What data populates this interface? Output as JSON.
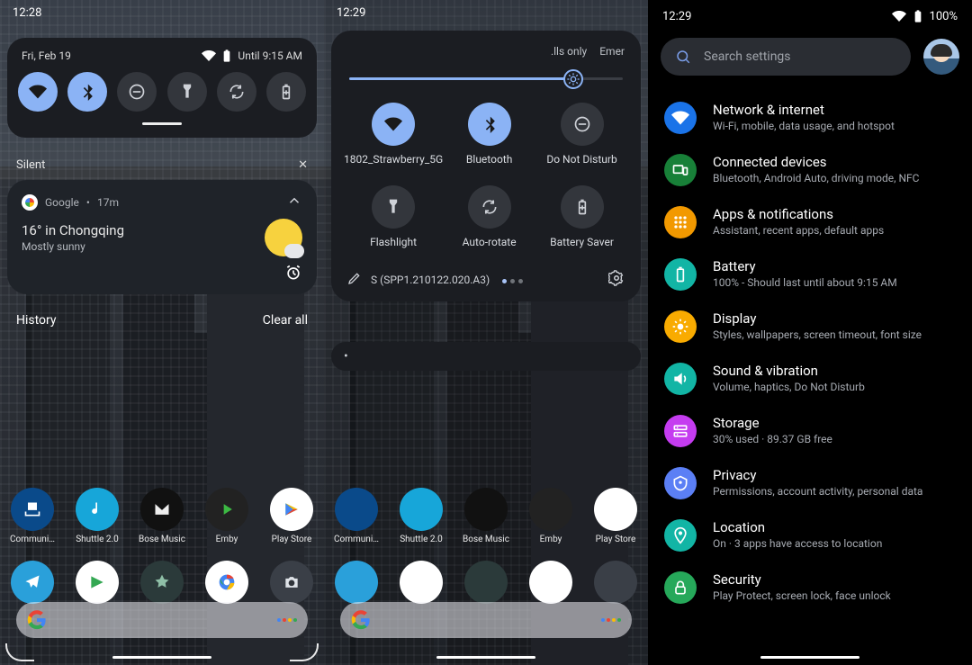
{
  "panel1": {
    "clock": "12:28",
    "date": "Fri, Feb 19",
    "until": "Until 9:15 AM",
    "qs": [
      {
        "name": "wifi",
        "on": true
      },
      {
        "name": "bluetooth",
        "on": true
      },
      {
        "name": "dnd",
        "on": false
      },
      {
        "name": "flashlight",
        "on": false
      },
      {
        "name": "autorotate",
        "on": false
      },
      {
        "name": "battery-saver",
        "on": false
      }
    ],
    "silent_label": "Silent",
    "notif": {
      "source": "Google",
      "age": "17m",
      "title": "16° in Chongqing",
      "sub": "Mostly sunny"
    },
    "history": "History",
    "clear_all": "Clear all",
    "apps": [
      "Communi…",
      "Shuttle 2.0",
      "Bose Music",
      "Emby",
      "Play Store"
    ]
  },
  "panel2": {
    "clock": "12:29",
    "ticker": [
      ".lls only",
      "Emer"
    ],
    "brightness_pct": 82,
    "tiles": [
      {
        "label": "1802_Strawberry_5G",
        "icon": "wifi",
        "on": true
      },
      {
        "label": "Bluetooth",
        "icon": "bluetooth",
        "on": true
      },
      {
        "label": "Do Not Disturb",
        "icon": "dnd",
        "on": false
      },
      {
        "label": "Flashlight",
        "icon": "flashlight",
        "on": false
      },
      {
        "label": "Auto-rotate",
        "icon": "autorotate",
        "on": false
      },
      {
        "label": "Battery Saver",
        "icon": "battery-saver",
        "on": false
      }
    ],
    "build": "S (SPP1.210122.020.A3)",
    "media_dot": "•",
    "apps": [
      "Communi…",
      "Shuttle 2.0",
      "Bose Music",
      "Emby",
      "Play Store"
    ]
  },
  "panel3": {
    "clock": "12:29",
    "battery": "100%",
    "search_placeholder": "Search settings",
    "items": [
      {
        "title": "Network & internet",
        "sub": "Wi-Fi, mobile, data usage, and hotspot",
        "color": "#1a73e8",
        "icon": "wifi"
      },
      {
        "title": "Connected devices",
        "sub": "Bluetooth, Android Auto, driving mode, NFC",
        "color": "#188038",
        "icon": "devices"
      },
      {
        "title": "Apps & notifications",
        "sub": "Assistant, recent apps, default apps",
        "color": "#f29900",
        "icon": "apps"
      },
      {
        "title": "Battery",
        "sub": "100% - Should last until about 9:15 AM",
        "color": "#12b5a5",
        "icon": "battery"
      },
      {
        "title": "Display",
        "sub": "Styles, wallpapers, screen timeout, font size",
        "color": "#f9ab00",
        "icon": "display"
      },
      {
        "title": "Sound & vibration",
        "sub": "Volume, haptics, Do Not Disturb",
        "color": "#12b5a5",
        "icon": "sound"
      },
      {
        "title": "Storage",
        "sub": "30% used · 89.37 GB free",
        "color": "#c53cf0",
        "icon": "storage"
      },
      {
        "title": "Privacy",
        "sub": "Permissions, account activity, personal data",
        "color": "#5b7ff5",
        "icon": "privacy"
      },
      {
        "title": "Location",
        "sub": "On · 3 apps have access to location",
        "color": "#12b5a5",
        "icon": "location"
      },
      {
        "title": "Security",
        "sub": "Play Protect, screen lock, face unlock",
        "color": "#26a85a",
        "icon": "security"
      }
    ]
  }
}
